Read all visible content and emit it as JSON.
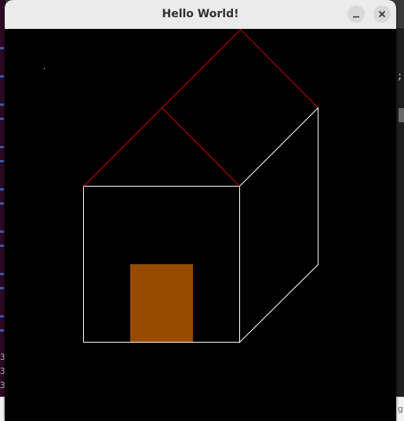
{
  "window": {
    "title": "Hello World!",
    "minimize_icon": "minimize-icon",
    "close_icon": "close-icon"
  },
  "background": {
    "left_strip_digits": [
      "3",
      "3",
      "3"
    ],
    "right_strip_glyph": ";",
    "bottom_bar_clip_text": "gl"
  },
  "drawing": {
    "background_color": "#000000",
    "wall_stroke_color": "#ffffff",
    "roof_stroke_color": "#cc0000",
    "door_fill_color": "#964b00",
    "shapes": [
      "front-wall",
      "side-wall",
      "front-roof",
      "side-roof",
      "door",
      "stray-pixel"
    ]
  }
}
